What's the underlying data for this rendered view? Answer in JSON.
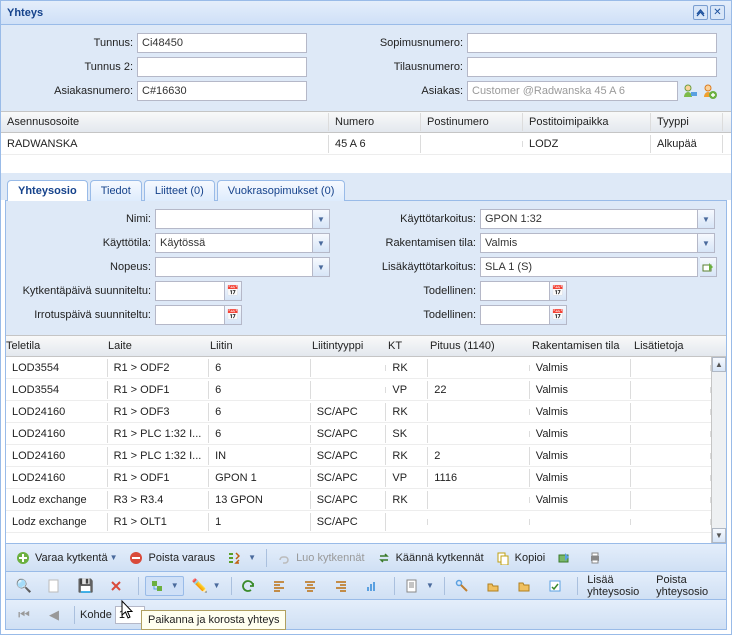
{
  "window": {
    "title": "Yhteys"
  },
  "form": {
    "tunnus_lbl": "Tunnus:",
    "tunnus": "Ci48450",
    "tunnus2_lbl": "Tunnus 2:",
    "tunnus2": "",
    "asiakasnro_lbl": "Asiakasnumero:",
    "asiakasnro": "C#16630",
    "sopimus_lbl": "Sopimusnumero:",
    "sopimus": "",
    "tilaus_lbl": "Tilausnumero:",
    "tilaus": "",
    "asiakas_lbl": "Asiakas:",
    "asiakas": "Customer @Radwanska 45 A 6"
  },
  "addr_grid": {
    "headers": {
      "c1": "Asennusosoite",
      "c2": "Numero",
      "c3": "Postinumero",
      "c4": "Postitoimipaikka",
      "c5": "Tyyppi"
    },
    "rows": [
      {
        "c1": "RADWANSKA",
        "c2": "45 A 6",
        "c3": "",
        "c4": "LODZ",
        "c5": "Alkupää"
      }
    ]
  },
  "tabs": {
    "t1": "Yhteysosio",
    "t2": "Tiedot",
    "t3": "Liitteet (0)",
    "t4": "Vuokrasopimukset (0)"
  },
  "detail": {
    "nimi_lbl": "Nimi:",
    "nimi": "",
    "kayttotila_lbl": "Käyttötila:",
    "kayttotila": "Käytössä",
    "nopeus_lbl": "Nopeus:",
    "nopeus": "",
    "kytk_lbl": "Kytkentäpäivä suunniteltu:",
    "kytk": "",
    "irro_lbl": "Irrotuspäivä suunniteltu:",
    "irro": "",
    "kaytto_lbl": "Käyttötarkoitus:",
    "kaytto": "GPON 1:32",
    "raktila_lbl": "Rakentamisen tila:",
    "raktila": "Valmis",
    "lisak_lbl": "Lisäkäyttötarkoitus:",
    "lisak": "SLA 1 (S)",
    "tod1_lbl": "Todellinen:",
    "tod1": "",
    "tod2_lbl": "Todellinen:",
    "tod2": ""
  },
  "grid2": {
    "headers": {
      "c1": "Teletila",
      "c2": "Laite",
      "c3": "Liitin",
      "c4": "Liitintyyppi",
      "c5": "KT",
      "c6": "Pituus (1140)",
      "c7": "Rakentamisen tila",
      "c8": "Lisätietoja"
    },
    "rows": [
      {
        "c1": "LOD3554",
        "c2": "R1 > ODF2",
        "c3": "6",
        "c4": "",
        "c5": "RK",
        "c6": "",
        "c7": "Valmis",
        "c8": ""
      },
      {
        "c1": "LOD3554",
        "c2": "R1 > ODF1",
        "c3": "6",
        "c4": "",
        "c5": "VP",
        "c6": "22",
        "c7": "Valmis",
        "c8": ""
      },
      {
        "c1": "LOD24160",
        "c2": "R1 > ODF3",
        "c3": "6",
        "c4": "SC/APC",
        "c5": "RK",
        "c6": "",
        "c7": "Valmis",
        "c8": ""
      },
      {
        "c1": "LOD24160",
        "c2": "R1 > PLC 1:32 I...",
        "c3": "6",
        "c4": "SC/APC",
        "c5": "SK",
        "c6": "",
        "c7": "Valmis",
        "c8": ""
      },
      {
        "c1": "LOD24160",
        "c2": "R1 > PLC 1:32 I...",
        "c3": "IN",
        "c4": "SC/APC",
        "c5": "RK",
        "c6": "2",
        "c7": "Valmis",
        "c8": ""
      },
      {
        "c1": "LOD24160",
        "c2": "R1 > ODF1",
        "c3": "GPON 1",
        "c4": "SC/APC",
        "c5": "VP",
        "c6": "1116",
        "c7": "Valmis",
        "c8": ""
      },
      {
        "c1": "Lodz exchange",
        "c2": "R3 > R3.4",
        "c3": "13 GPON",
        "c4": "SC/APC",
        "c5": "RK",
        "c6": "",
        "c7": "Valmis",
        "c8": ""
      },
      {
        "c1": "Lodz exchange",
        "c2": "R1 > OLT1",
        "c3": "1",
        "c4": "SC/APC",
        "c5": "",
        "c6": "",
        "c7": "",
        "c8": ""
      }
    ]
  },
  "toolbar1": {
    "varaa": "Varaa kytkentä",
    "poista": "Poista varaus",
    "luo": "Luo kytkennät",
    "kaanna": "Käännä kytkennät",
    "kopioi": "Kopioi"
  },
  "toolbar2": {
    "lisaa": "Lisää yhteysosio",
    "poistao": "Poista yhteysosio"
  },
  "paging": {
    "kohde": "Kohde",
    "page": "1"
  },
  "tooltip": "Paikanna ja korosta yhteys"
}
